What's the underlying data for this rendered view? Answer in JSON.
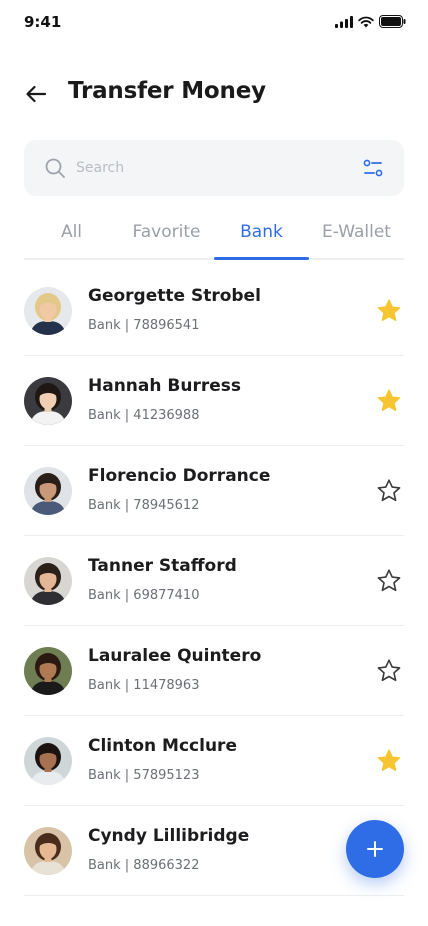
{
  "status_bar": {
    "time": "9:41"
  },
  "header": {
    "title": "Transfer Money"
  },
  "search": {
    "placeholder": "Search"
  },
  "tabs": [
    {
      "label": "All",
      "active": false
    },
    {
      "label": "Favorite",
      "active": false
    },
    {
      "label": "Bank",
      "active": true
    },
    {
      "label": "E-Wallet",
      "active": false
    }
  ],
  "contacts": [
    {
      "name": "Georgette Strobel",
      "detail": "Bank | 78896541",
      "favorite": true,
      "skin": "#f1c9a5",
      "hair": "#e3c88a",
      "bg": "#e6e8ec",
      "shirt": "#23324a"
    },
    {
      "name": "Hannah Burress",
      "detail": "Bank | 41236988",
      "favorite": true,
      "skin": "#f0cfb4",
      "hair": "#1e1714",
      "bg": "#3b3a3e",
      "shirt": "#f2f2f2"
    },
    {
      "name": "Florencio Dorrance",
      "detail": "Bank | 78945612",
      "favorite": false,
      "skin": "#c99a79",
      "hair": "#2a1f18",
      "bg": "#dfe2e6",
      "shirt": "#4a5a78"
    },
    {
      "name": "Tanner Stafford",
      "detail": "Bank | 69877410",
      "favorite": false,
      "skin": "#e3b696",
      "hair": "#2b2019",
      "bg": "#d8d6d2",
      "shirt": "#2f2f33"
    },
    {
      "name": "Lauralee Quintero",
      "detail": "Bank | 11478963",
      "favorite": false,
      "skin": "#b07a55",
      "hair": "#2a1a12",
      "bg": "#6f7d52",
      "shirt": "#1a1a1a"
    },
    {
      "name": "Clinton Mcclure",
      "detail": "Bank | 57895123",
      "favorite": true,
      "skin": "#a87152",
      "hair": "#1b1410",
      "bg": "#cfd6d8",
      "shirt": "#e9ecef"
    },
    {
      "name": "Cyndy Lillibridge",
      "detail": "Bank | 88966322",
      "favorite": false,
      "skin": "#e7b894",
      "hair": "#4a2c1c",
      "bg": "#d9c3a8",
      "shirt": "#e8e1d6"
    }
  ],
  "colors": {
    "accent": "#2f6de6",
    "star_filled": "#f7c531",
    "star_outline": "#3a3a3c"
  },
  "icons": {
    "back": "arrow-left-icon",
    "search": "search-icon",
    "filter": "filter-icon",
    "fab": "plus-icon"
  }
}
